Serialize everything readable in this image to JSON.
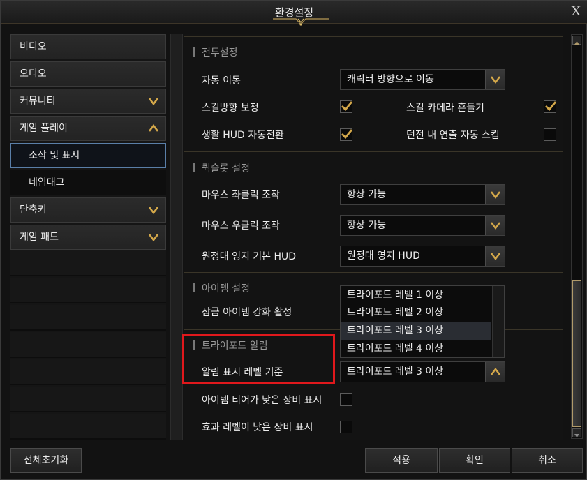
{
  "window": {
    "title": "환경설정",
    "close_label": "X"
  },
  "sidebar": {
    "items": [
      {
        "label": "비디오"
      },
      {
        "label": "오디오"
      },
      {
        "label": "커뮤니티"
      },
      {
        "label": "게임 플레이"
      },
      {
        "label": "조작 및 표시"
      },
      {
        "label": "네임태그"
      },
      {
        "label": "단축키"
      },
      {
        "label": "게임 패드"
      }
    ]
  },
  "sections": {
    "combat": {
      "title": "전투설정",
      "auto_move_label": "자동 이동",
      "auto_move_value": "캐릭터 방향으로 이동",
      "skill_dir_label": "스킬방향 보정",
      "skill_cam_shake_label": "스킬 카메라 흔들기",
      "life_hud_label": "생활 HUD 자동전환",
      "dungeon_skip_label": "던전 내 연출 자동 스킵"
    },
    "quickslot": {
      "title": "퀵슬롯 설정",
      "left_click_label": "마우스 좌클릭 조작",
      "left_click_value": "항상 가능",
      "right_click_label": "마우스 우클릭 조작",
      "right_click_value": "항상 가능",
      "expedition_label": "원정대 영지 기본 HUD",
      "expedition_value": "원정대 영지 HUD"
    },
    "item": {
      "title": "아이템 설정",
      "lock_label": "잠금 아이템 강화 활성"
    },
    "tripod": {
      "title": "트라이포드 알림",
      "level_label": "알림 표시 레벨 기준",
      "level_value": "트라이포드 레벨 3 이상",
      "low_tier_label": "아이템 티어가 낮은 장비 표시",
      "low_effect_label": "효과 레벨이 낮은 장비 표시"
    }
  },
  "dropdown_options": [
    "트라이포드 레벨 1 이상",
    "트라이포드 레벨 2 이상",
    "트라이포드 레벨 3 이상",
    "트라이포드 레벨 4 이상"
  ],
  "footer": {
    "reset_label": "전체초기화",
    "apply_label": "적용",
    "confirm_label": "확인",
    "cancel_label": "취소"
  },
  "colors": {
    "accent_gold": "#d4a84a",
    "highlight_red": "#e0181c"
  }
}
